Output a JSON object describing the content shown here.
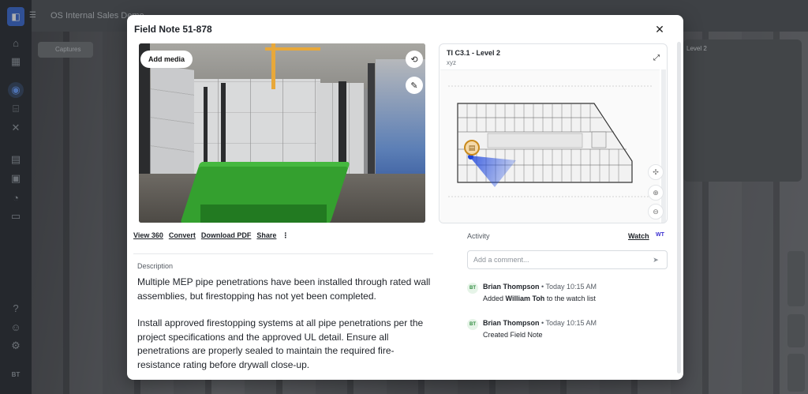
{
  "background": {
    "project_title": "OS Internal Sales Demo",
    "captures_label": "Captures",
    "panel_title": "Level 2",
    "user_initials": "BT"
  },
  "modal": {
    "title": "Field Note 51-878",
    "close_icon": "close-icon",
    "photo": {
      "add_media_label": "Add media"
    },
    "actions": {
      "view360": "View 360",
      "convert": "Convert",
      "download_pdf": "Download PDF",
      "share": "Share",
      "more": "⋮"
    },
    "description": {
      "label": "Description",
      "paragraph1": "Multiple MEP pipe penetrations have been installed through rated wall assemblies, but firestopping has not yet been completed.",
      "paragraph2": "Install approved firestopping systems at all pipe penetrations per the project specifications and the approved UL detail. Ensure all penetrations are properly sealed to maintain the required fire-resistance rating before drywall close-up."
    },
    "plan": {
      "title": "TI C3.1 - Level 2",
      "subtitle": "xyz"
    },
    "activity": {
      "label": "Activity",
      "watch_label": "Watch",
      "watcher_initials": "WT",
      "comment_placeholder": "Add a comment...",
      "entries": [
        {
          "initials": "BT",
          "author": "Brian Thompson",
          "separator": "•",
          "time": "Today 10:15 AM",
          "text_prefix": "Added",
          "text_bold": "William Toh",
          "text_suffix": "to the watch list"
        },
        {
          "initials": "BT",
          "author": "Brian Thompson",
          "separator": "•",
          "time": "Today 10:15 AM",
          "text": "Created Field Note"
        }
      ]
    }
  },
  "colors": {
    "accent": "#3b2fd1",
    "pin": "#c98a1c",
    "avatar_green": "#2f8a3e"
  }
}
